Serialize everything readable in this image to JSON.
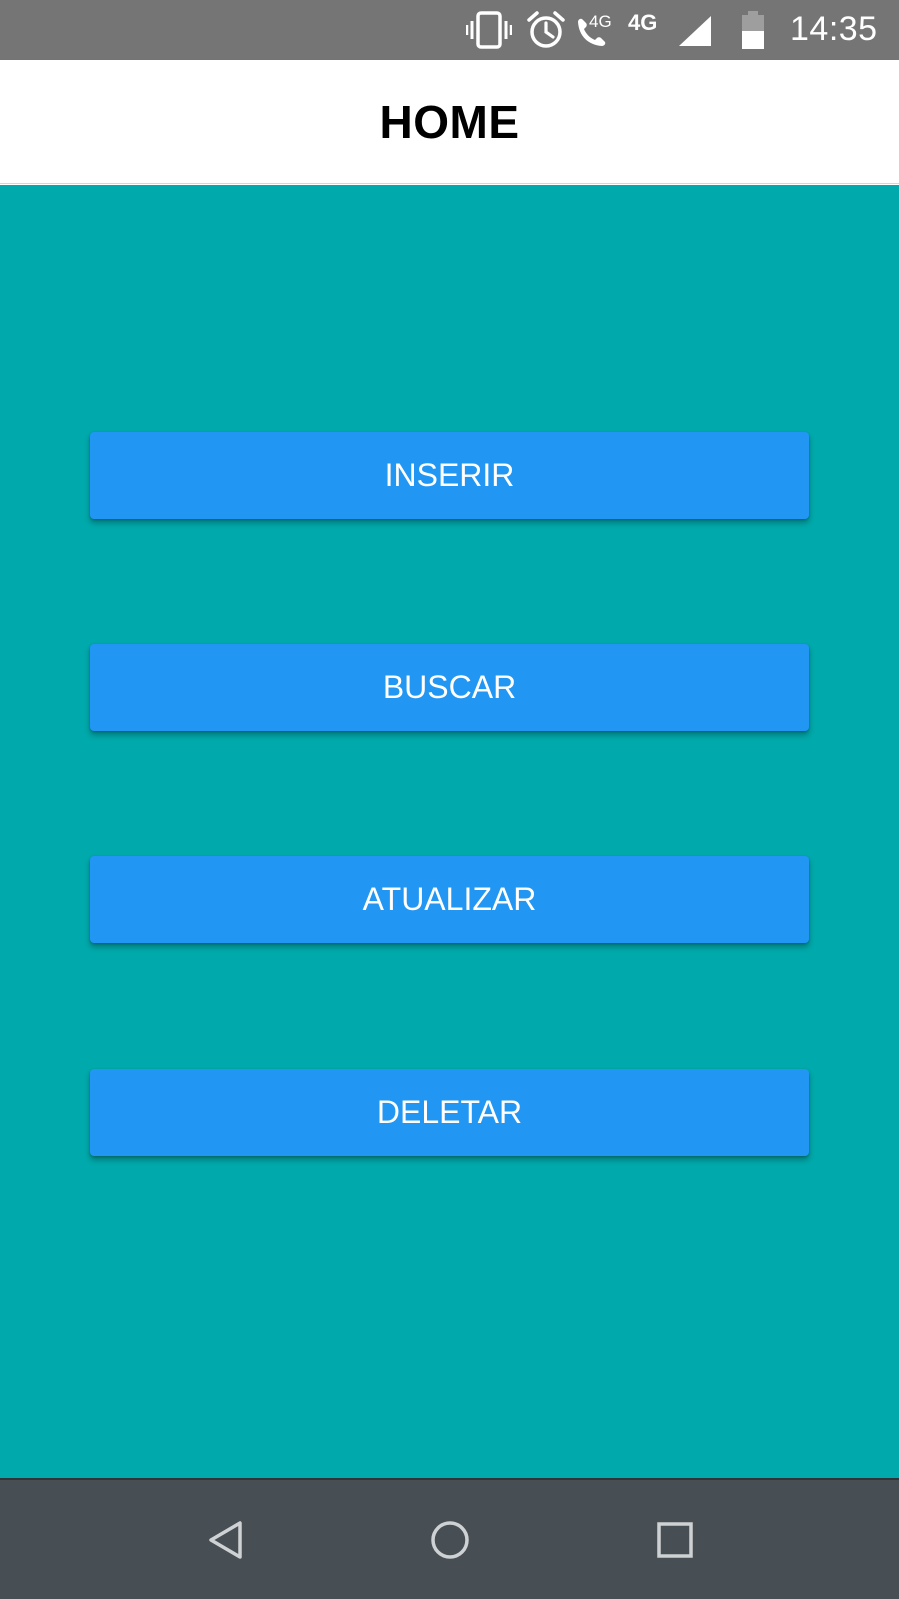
{
  "status_bar": {
    "time": "14:35",
    "call_network_label": "4G",
    "network_label": "4G",
    "icons": [
      "vibrate-icon",
      "alarm-icon",
      "wifi-call-icon",
      "signal-icon",
      "battery-icon"
    ]
  },
  "header": {
    "title": "HOME"
  },
  "menu": {
    "buttons": [
      {
        "label": "INSERIR"
      },
      {
        "label": "BUSCAR"
      },
      {
        "label": "ATUALIZAR"
      },
      {
        "label": "DELETAR"
      }
    ]
  },
  "nav_bar": {
    "icons": [
      "back-icon",
      "home-icon",
      "recents-icon"
    ]
  },
  "colors": {
    "status_bar": "#757575",
    "header_bg": "#FFFFFF",
    "content_bg": "#00A9AB",
    "button_bg": "#2196F3",
    "button_text": "#FFFFFF",
    "nav_bar": "#474E54"
  }
}
